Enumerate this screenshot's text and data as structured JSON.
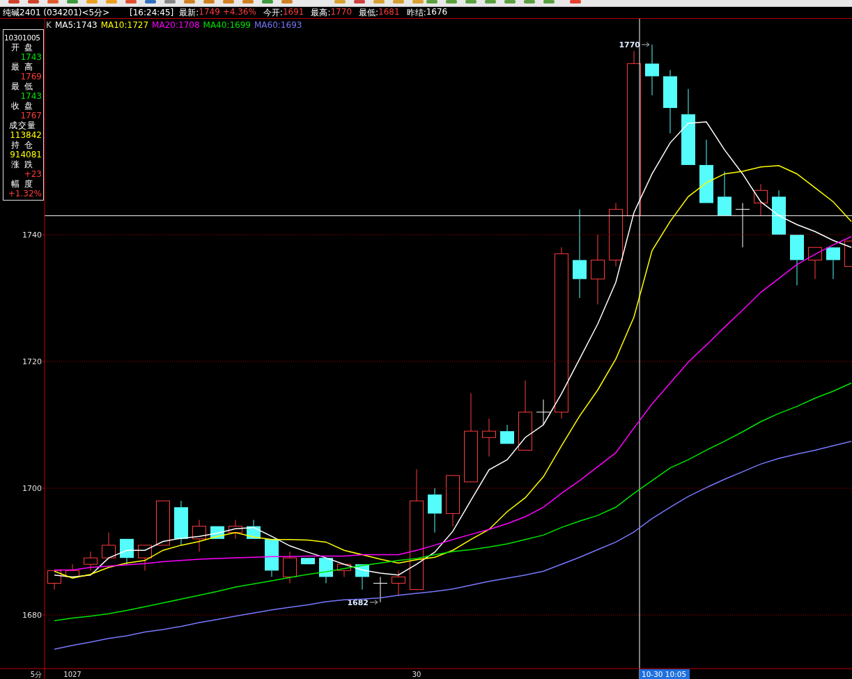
{
  "header": {
    "symbol": "纯碱2401 (034201)<5分>",
    "time": "[16:24:45]",
    "quotes": [
      {
        "label": "最新:",
        "value": "1749 +4.36%",
        "color": "#ff3c3c"
      },
      {
        "label": "今开:",
        "value": "1691",
        "color": "#ff3c3c"
      },
      {
        "label": "最高:",
        "value": "1770",
        "color": "#ff3c3c"
      },
      {
        "label": "最低:",
        "value": "1681",
        "color": "#ff3c3c"
      },
      {
        "label": "昨结:",
        "value": "1676",
        "color": "#ffffff"
      }
    ]
  },
  "legend": {
    "kind": "K",
    "values": [
      ":1743",
      ":1727",
      ":1708",
      ":1699",
      ":1693"
    ]
  },
  "info_panel": {
    "date": "10301005",
    "rows": [
      {
        "label": "开盘",
        "value": "1743",
        "color": "#00e600"
      },
      {
        "label": "最高",
        "value": "1769",
        "color": "#ff3c3c"
      },
      {
        "label": "最低",
        "value": "1743",
        "color": "#00e600"
      },
      {
        "label": "收盘",
        "value": "1767",
        "color": "#ff3c3c"
      },
      {
        "label": "成交量",
        "value": "113842",
        "color": "#ffff00"
      },
      {
        "label": "持仓",
        "value": "914081",
        "color": "#ffff00"
      },
      {
        "label": "涨跌",
        "value": "+23",
        "color": "#ff3c3c"
      },
      {
        "label": "幅度",
        "value": "+1.32%",
        "color": "#ff3c3c"
      }
    ]
  },
  "chart_data": {
    "type": "line",
    "ylim": [
      1671.54,
      1774.07
    ],
    "yticks": [
      1680,
      1700,
      1720,
      1740
    ],
    "grid": true,
    "annotations": [
      "1770",
      "1682"
    ],
    "series": [
      {
        "name": "MA5",
        "color": "#ffffff",
        "values": [
          1686.3,
          1686.0,
          1686.3,
          1689.0,
          1690.2,
          1690.2,
          1691.6,
          1692.1,
          1692.4,
          1692.9,
          1693.6,
          1693.8,
          1692.4,
          1690.9,
          1689.9,
          1689.0,
          1688.0,
          1687.1,
          1686.6,
          1686.3,
          1688.0,
          1689.9,
          1693.2,
          1698.1,
          1702.9,
          1704.5,
          1708.0,
          1710.0,
          1714.9,
          1720.4,
          1725.9,
          1732.5,
          1743.5,
          1749.6,
          1754.5,
          1757.6,
          1757.8,
          1753.4,
          1749.6,
          1745.2,
          1743.0,
          1741.6,
          1740.5,
          1739.1,
          1738.0
        ]
      },
      {
        "name": "MA10",
        "color": "#ffff00",
        "values": [
          1686.9,
          1685.8,
          1686.4,
          1687.5,
          1688.2,
          1688.6,
          1690.2,
          1691.0,
          1691.6,
          1692.4,
          1693.0,
          1692.3,
          1691.9,
          1691.9,
          1691.8,
          1691.5,
          1690.2,
          1689.5,
          1688.8,
          1688.2,
          1688.7,
          1689.1,
          1690.2,
          1691.9,
          1693.5,
          1696.3,
          1698.5,
          1701.8,
          1706.7,
          1711.4,
          1715.5,
          1720.4,
          1727.0,
          1737.5,
          1742.1,
          1746.0,
          1748.2,
          1749.6,
          1750.0,
          1750.7,
          1750.9,
          1749.6,
          1747.4,
          1745.2,
          1742.1
        ]
      },
      {
        "name": "MA20",
        "color": "#ff00ff",
        "values": [
          1687.1,
          1687.1,
          1687.5,
          1687.7,
          1687.9,
          1688.1,
          1688.4,
          1688.6,
          1688.8,
          1688.9,
          1689.0,
          1689.1,
          1689.2,
          1689.2,
          1689.3,
          1689.3,
          1689.3,
          1689.5,
          1689.5,
          1689.5,
          1690.2,
          1691.0,
          1691.9,
          1692.7,
          1693.5,
          1694.4,
          1695.5,
          1697.0,
          1699.2,
          1701.2,
          1703.4,
          1705.6,
          1709.5,
          1713.3,
          1716.6,
          1719.9,
          1722.6,
          1725.4,
          1728.1,
          1730.9,
          1733.1,
          1735.3,
          1736.9,
          1738.4,
          1739.7
        ]
      },
      {
        "name": "MA40",
        "color": "#00e600",
        "values": [
          1679.1,
          1679.5,
          1679.8,
          1680.2,
          1680.7,
          1681.3,
          1681.9,
          1682.5,
          1683.1,
          1683.7,
          1684.4,
          1684.9,
          1685.4,
          1685.9,
          1686.4,
          1686.8,
          1687.3,
          1687.8,
          1688.2,
          1688.6,
          1688.9,
          1689.5,
          1690.0,
          1690.3,
          1690.7,
          1691.2,
          1691.9,
          1692.6,
          1693.8,
          1694.8,
          1695.7,
          1697.0,
          1699.2,
          1701.2,
          1703.2,
          1704.5,
          1706.0,
          1707.4,
          1708.9,
          1710.5,
          1711.8,
          1712.9,
          1714.2,
          1715.3,
          1716.6
        ]
      },
      {
        "name": "MA60",
        "color": "#7878ff",
        "values": [
          1674.6,
          1675.2,
          1675.7,
          1676.3,
          1676.7,
          1677.3,
          1677.7,
          1678.2,
          1678.8,
          1679.3,
          1679.8,
          1680.3,
          1680.8,
          1681.2,
          1681.6,
          1682.1,
          1682.4,
          1682.5,
          1682.7,
          1683.1,
          1683.4,
          1683.7,
          1684.1,
          1684.7,
          1685.3,
          1685.8,
          1686.3,
          1686.9,
          1688.0,
          1689.1,
          1690.3,
          1691.5,
          1693.1,
          1695.2,
          1697.0,
          1698.7,
          1700.1,
          1701.4,
          1702.6,
          1703.8,
          1704.7,
          1705.4,
          1706.0,
          1706.7,
          1707.4
        ]
      }
    ]
  },
  "time_axis": {
    "period": "5分",
    "labels": [
      "1027",
      "30"
    ],
    "cursor_label": "10-30 10:05"
  }
}
